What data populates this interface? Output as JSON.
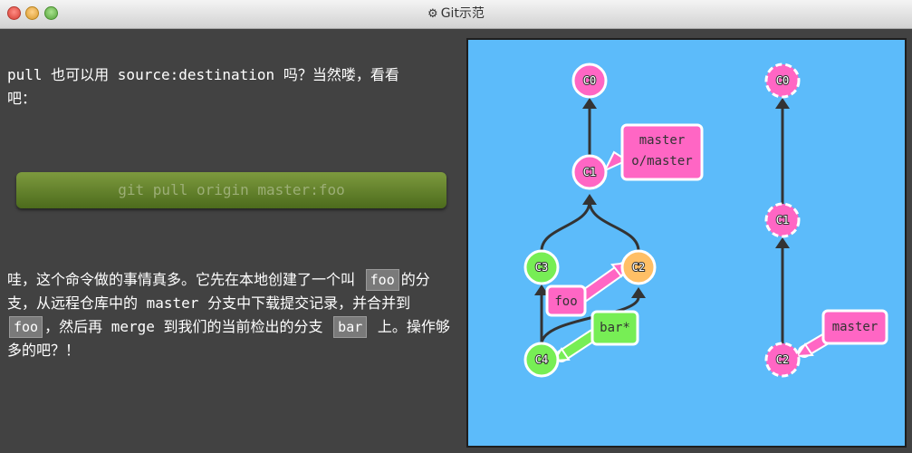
{
  "window": {
    "title": "Git示范",
    "gear_glyph": "⚙"
  },
  "intro": {
    "text_before": "pull 也可以用 source:destination 吗？当然喽，看看",
    "text_after": "吧："
  },
  "command": "git pull origin master:foo",
  "explanation": {
    "p1": "哇，这个命令做的事情真多。它先在本地创建了一个叫 ",
    "foo1": "foo",
    "p2": "的分支，从远程仓库中的 master 分支中下载提交记录，并合并到 ",
    "foo2": "foo",
    "p3": "，然后再 merge 到我们的当前检出的分支 ",
    "bar": "bar",
    "p4": " 上。操作够多的吧？！"
  },
  "graph": {
    "local": {
      "commits": {
        "c0": "C0",
        "c1": "C1",
        "c2": "C2",
        "c3": "C3",
        "c4": "C4"
      },
      "labels": {
        "master": "master",
        "o_master": "o/master",
        "foo": "foo",
        "bar": "bar*"
      }
    },
    "remote": {
      "commits": {
        "c0": "C0",
        "c1": "C1",
        "c2": "C2"
      },
      "labels": {
        "master": "master"
      }
    }
  },
  "colors": {
    "commit_pink": "#ff66c4",
    "commit_green": "#77ee55",
    "commit_orange": "#ffbf66",
    "panel_bg": "#5cbbfa",
    "command_bg": "#5d7a28"
  }
}
